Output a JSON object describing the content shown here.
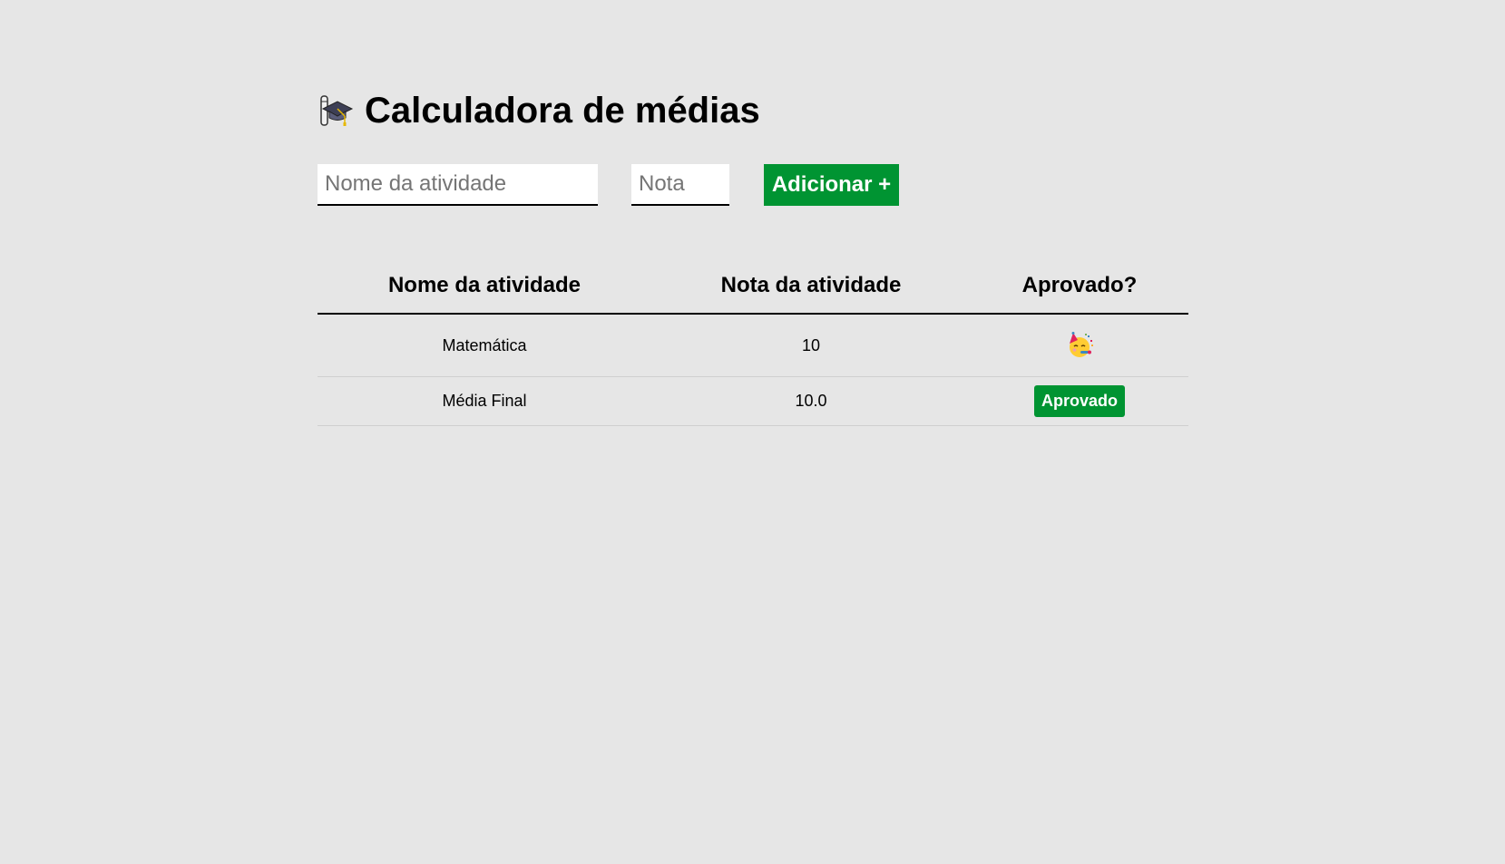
{
  "header": {
    "icon": "graduation-cap-icon",
    "title": "Calculadora de médias"
  },
  "form": {
    "activity_name": {
      "value": "",
      "placeholder": "Nome da atividade"
    },
    "grade": {
      "value": "",
      "placeholder": "Nota"
    },
    "add_button_label": "Adicionar +"
  },
  "table": {
    "headers": [
      "Nome da atividade",
      "Nota da atividade",
      "Aprovado?"
    ],
    "rows": [
      {
        "name": "Matemática",
        "grade": "10",
        "status_icon": "partying-face-icon"
      }
    ],
    "final": {
      "name": "Média Final",
      "grade": "10.0",
      "status_label": "Aprovado"
    }
  },
  "colors": {
    "background": "#e6e6e6",
    "accent_green": "#009432"
  }
}
